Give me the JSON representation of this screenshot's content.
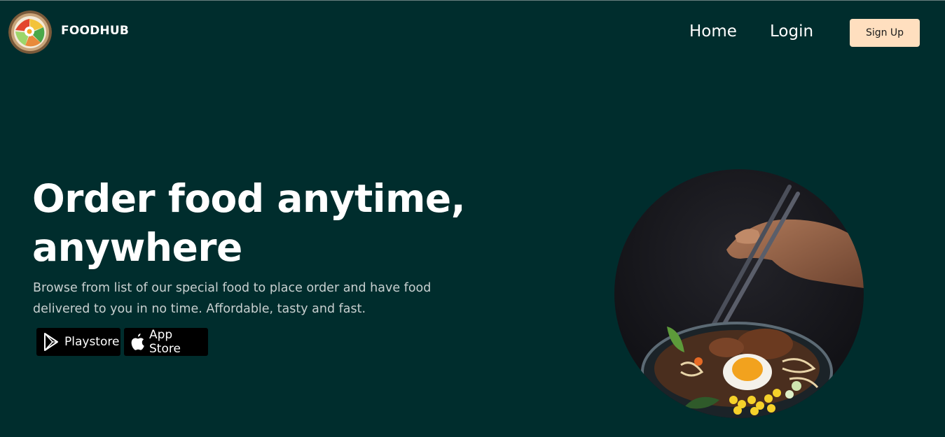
{
  "header": {
    "brand": "FOODHUB",
    "logo_icon": "food-bowl-logo-icon",
    "nav": {
      "home": "Home",
      "login": "Login",
      "signup": "Sign Up"
    }
  },
  "hero": {
    "title_line1": "Order food anytime,",
    "title_line2": "anywhere",
    "subtitle": "Browse from list of our special food to place order and have food delivered to you in no time. Affordable, tasty and fast.",
    "buttons": {
      "playstore": {
        "label": "Playstore",
        "icon": "google-play-icon"
      },
      "appstore": {
        "label": "App Store",
        "icon": "apple-icon"
      }
    },
    "image_icon": "ramen-bowl-with-chopsticks-image"
  },
  "colors": {
    "background": "#002d2d",
    "signup_button": "#ffdfbf",
    "store_button": "#000000",
    "text": "#ffffff"
  }
}
